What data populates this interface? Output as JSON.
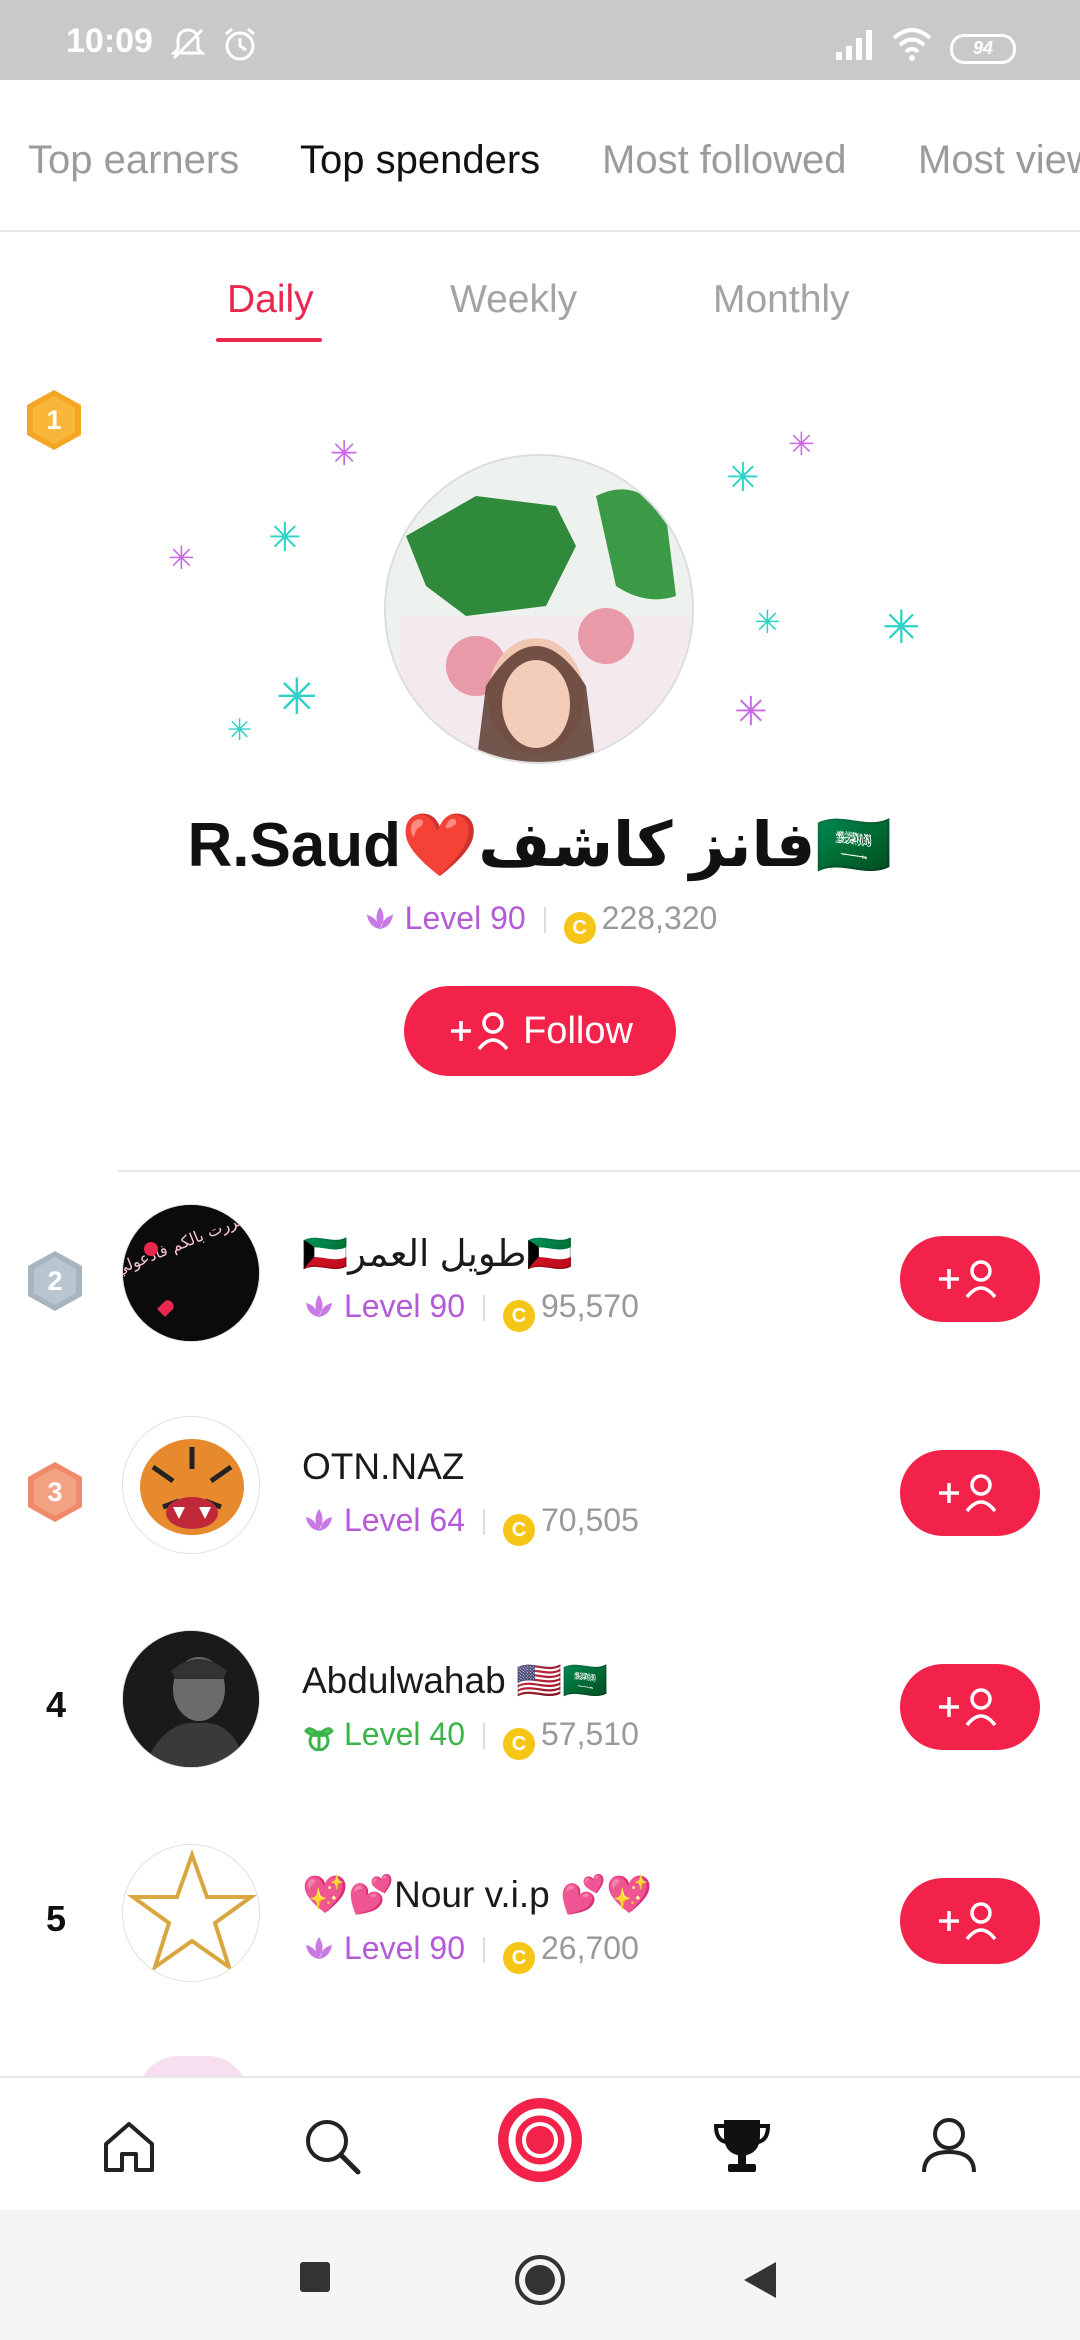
{
  "status_bar": {
    "time": "10:09",
    "battery": "94"
  },
  "top_tabs": [
    {
      "label": "Top earners",
      "active": false
    },
    {
      "label": "Top spenders",
      "active": true
    },
    {
      "label": "Most followed",
      "active": false
    },
    {
      "label": "Most viewed",
      "active": false
    }
  ],
  "period_tabs": [
    {
      "label": "Daily",
      "active": true
    },
    {
      "label": "Weekly",
      "active": false
    },
    {
      "label": "Monthly",
      "active": false
    }
  ],
  "top_spender": {
    "rank": "1",
    "name": "R.Saud❤️فانز كاشف🇸🇦",
    "level": "Level 90",
    "coins": "228,320",
    "follow_label": "Follow"
  },
  "list": [
    {
      "rank": "2",
      "name": "🇰🇼طويل العمر🇰🇼",
      "level": "Level 90",
      "coins": "95,570",
      "level_color": "purple"
    },
    {
      "rank": "3",
      "name": "OTN.NAZ",
      "level": "Level 64",
      "coins": "70,505",
      "level_color": "purple"
    },
    {
      "rank": "4",
      "name": "Abdulwahab 🇺🇸🇸🇦",
      "level": "Level 40",
      "coins": "57,510",
      "level_color": "green"
    },
    {
      "rank": "5",
      "name": "💖💕Nour v.i.p 💕💖",
      "level": "Level 90",
      "coins": "26,700",
      "level_color": "purple"
    }
  ],
  "avatar_text": {
    "row2": "مغلق إذا مررت بالكم فادعولي بالسعاده"
  },
  "colors": {
    "accent": "#f2224a",
    "level_purple": "#b45ad9",
    "level_green": "#3bb44a",
    "gold": "#f5a623"
  },
  "icons": [
    "home-icon",
    "search-icon",
    "live-record-icon",
    "trophy-icon",
    "profile-icon"
  ]
}
